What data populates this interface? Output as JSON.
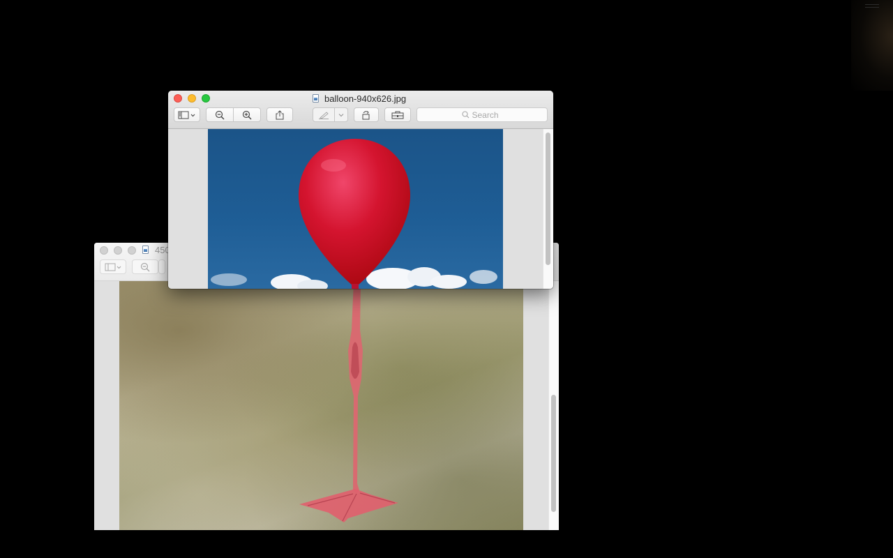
{
  "front_window": {
    "title": "balloon-940x626.jpg",
    "search": {
      "placeholder": "Search"
    },
    "toolbar": [
      "sidebar-toggle-icon",
      "zoom-out-icon",
      "zoom-in-icon",
      "share-icon",
      "markup-pen-icon",
      "rotate-icon",
      "toolbox-icon"
    ]
  },
  "back_window": {
    "title_partial": "450"
  },
  "colors": {
    "close": "#fc5f57",
    "minimize": "#fdbc2e",
    "maximize": "#28c840",
    "sky": "#1e5d95",
    "balloon": "#d0122b"
  }
}
